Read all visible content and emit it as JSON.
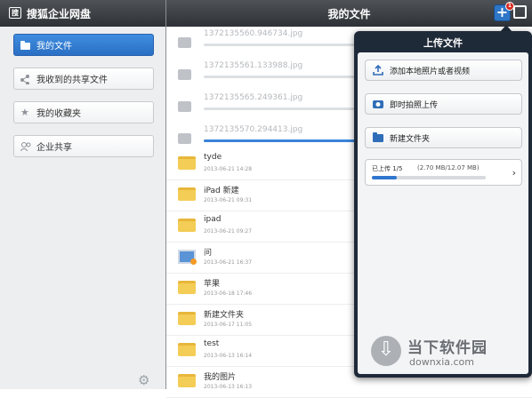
{
  "app": {
    "brand_title": "搜狐企业网盘",
    "page_title": "我的文件"
  },
  "header": {
    "badge_count": "1",
    "icons": [
      "plus-icon",
      "edit-icon"
    ]
  },
  "sidebar": {
    "items": [
      {
        "label": "我的文件",
        "icon": "folder-icon",
        "active": true
      },
      {
        "label": "我收到的共享文件",
        "icon": "share-icon",
        "active": false
      },
      {
        "label": "我的收藏夹",
        "icon": "star-icon",
        "active": false
      },
      {
        "label": "企业共享",
        "icon": "users-icon",
        "active": false
      }
    ],
    "settings_icon": "gear-icon"
  },
  "uploads": [
    {
      "name": "1372135560.946734.jpg",
      "progress": 0.0
    },
    {
      "name": "1372135561.133988.jpg",
      "progress": 0.0
    },
    {
      "name": "1372135565.249361.jpg",
      "progress": 0.0
    },
    {
      "name": "1372135570.294413.jpg",
      "progress": 1.0
    }
  ],
  "files": [
    {
      "name": "tyde",
      "date": "2013-06-21 14:28",
      "type": "folder"
    },
    {
      "name": "iPad 新建",
      "date": "2013-06-21 09:31",
      "type": "folder"
    },
    {
      "name": "ipad",
      "date": "2013-06-21 09:27",
      "type": "folder"
    },
    {
      "name": "问",
      "date": "2013-06-21 16:37",
      "type": "image"
    },
    {
      "name": "苹果",
      "date": "2013-06-18 17:46",
      "type": "folder"
    },
    {
      "name": "新建文件夹",
      "date": "2013-06-17 11:05",
      "type": "folder"
    },
    {
      "name": "test",
      "date": "2013-06-13 16:14",
      "type": "folder"
    },
    {
      "name": "我的图片",
      "date": "2013-06-13 16:13",
      "type": "folder"
    }
  ],
  "popover": {
    "title": "上传文件",
    "buttons": [
      {
        "label": "添加本地照片或者视频",
        "icon": "upload-icon"
      },
      {
        "label": "即时拍照上传",
        "icon": "camera-icon"
      },
      {
        "label": "新建文件夹",
        "icon": "folder-icon"
      }
    ],
    "progress": {
      "label": "已上传 1/5",
      "size": "(2.70 MB/12.07 MB)",
      "fraction": 0.22
    }
  },
  "watermark": {
    "title": "当下软件园",
    "url": "downxia.com"
  }
}
